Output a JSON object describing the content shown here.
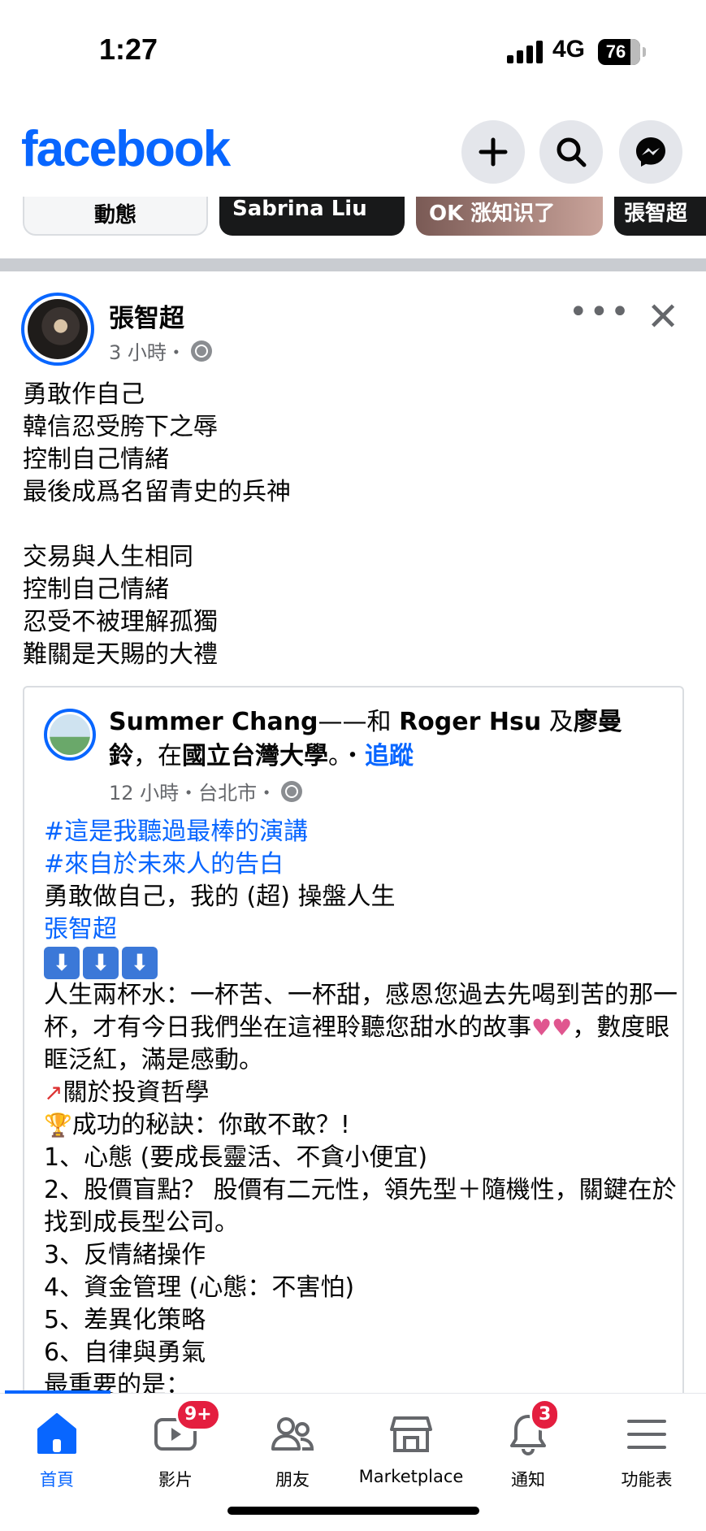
{
  "status": {
    "time": "1:27",
    "network": "4G",
    "battery": "76"
  },
  "header": {
    "logo": "facebook",
    "icons": [
      "plus-icon",
      "search-icon",
      "messenger-icon"
    ]
  },
  "stories": [
    "動態",
    "Sabrina Liu",
    "OK 涨知识了",
    "張智超"
  ],
  "post": {
    "author": "張智超",
    "time": "3 小時・",
    "lines": [
      "勇敢作自己",
      "韓信忍受胯下之辱",
      "控制自己情緒",
      "最後成爲名留青史的兵神",
      "",
      "交易與人生相同",
      "控制自己情緒",
      "忍受不被理解孤獨",
      "難關是天賜的大禮"
    ]
  },
  "shared": {
    "author": "Summer Chang",
    "dash": "——和 ",
    "tag1": "Roger Hsu",
    "and": " 及",
    "tag2": "廖曼鈴",
    "at": "，在",
    "place": "國立台灣大學",
    "period": "。・",
    "follow": "追蹤",
    "meta": "12 小時・台北市・",
    "hashtag1": "#這是我聽過最棒的演講",
    "hashtag2": "#來自於未來人的告白",
    "line1": "勇敢做自己，我的 (超) 操盤人生",
    "mention": "張智超",
    "arrows": "⬇",
    "para1": "人生兩杯水：一杯苦、一杯甜，感恩您過去先喝到苦的那一杯，才有今日我們坐在這裡聆聽您甜水的故事",
    "para1b": "，數度眼眶泛紅，滿是感動。",
    "item_chart": "關於投資哲學",
    "item_trophy": "成功的秘訣：你敢不敢？!",
    "list": [
      "1、心態 (要成長靈活、不貪小便宜)",
      "2、股價盲點？ 股價有二元性，領先型＋隨機性，關鍵在於找到成長型公司。",
      "3、反情緒操作",
      "4、資金管理 (心態：不害怕)",
      "5、差異化策略",
      "6、自律與勇氣",
      "最重要的是："
    ]
  },
  "nav": {
    "items": [
      {
        "label": "首頁",
        "icon": "home-icon"
      },
      {
        "label": "影片",
        "icon": "video-icon",
        "badge": "9+"
      },
      {
        "label": "朋友",
        "icon": "friends-icon"
      },
      {
        "label": "Marketplace",
        "icon": "marketplace-icon"
      },
      {
        "label": "通知",
        "icon": "bell-icon",
        "badge": "3"
      },
      {
        "label": "功能表",
        "icon": "menu-icon"
      }
    ]
  },
  "colors": {
    "brand": "#0866ff",
    "badge": "#e41e3f"
  }
}
